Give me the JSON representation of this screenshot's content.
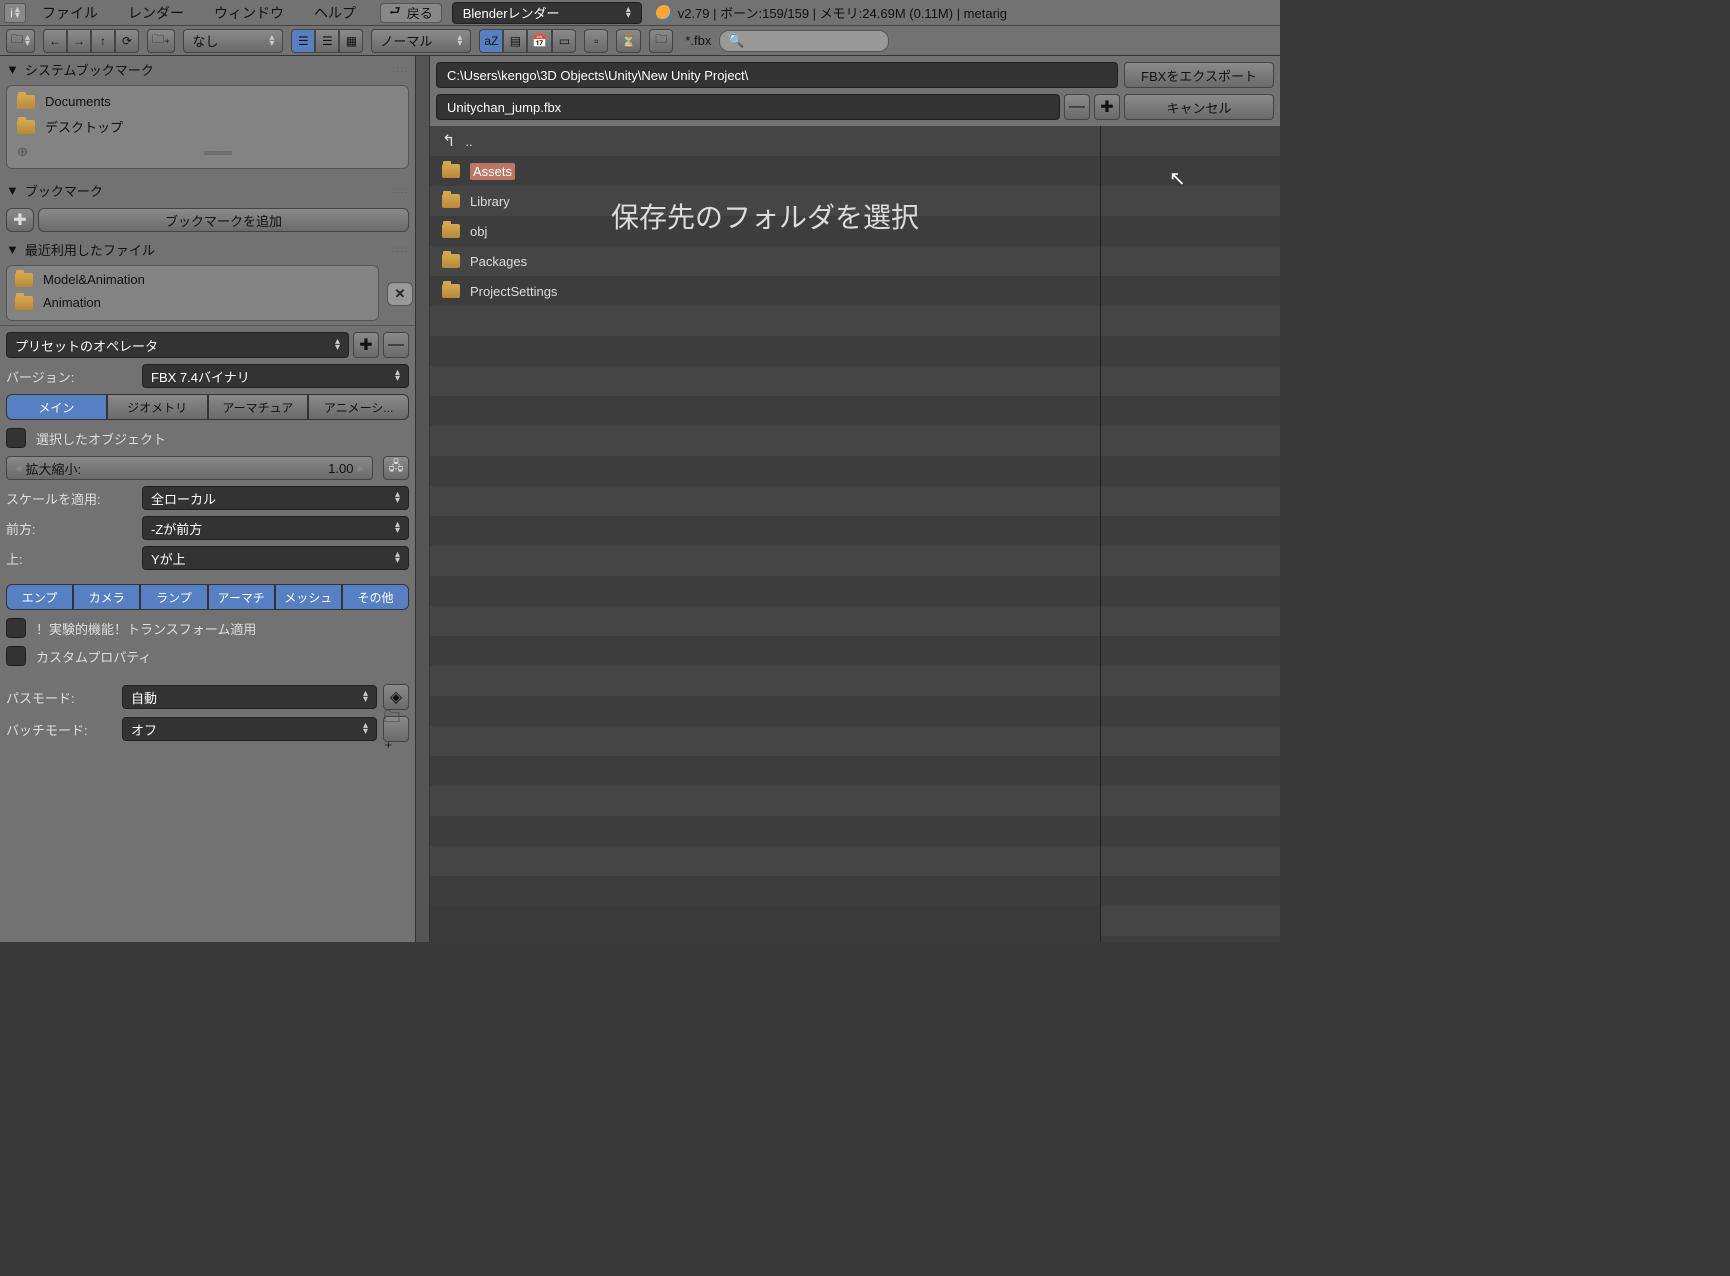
{
  "menubar": {
    "info_icon": "i",
    "items": [
      "ファイル",
      "レンダー",
      "ウィンドウ",
      "ヘルプ"
    ],
    "back": "戻る",
    "renderer": "Blenderレンダー",
    "status": "v2.79 | ボーン:159/159 | メモリ:24.69M (0.11M) | metarig"
  },
  "toolbar": {
    "none_label": "なし",
    "normal_label": "ノーマル",
    "filter_text": "*.fbx"
  },
  "system_bookmarks": {
    "title": "システムブックマーク",
    "items": [
      "Documents",
      "デスクトップ"
    ]
  },
  "bookmarks": {
    "title": "ブックマーク",
    "add_label": "ブックマークを追加"
  },
  "recent": {
    "title": "最近利用したファイル",
    "items": [
      "Model&Animation",
      "Animation"
    ]
  },
  "operator": {
    "title": "プリセットのオペレータ",
    "version_label": "バージョン:",
    "version_value": "FBX 7.4バイナリ",
    "tabs": [
      "メイン",
      "ジオメトリ",
      "アーマチュア",
      "アニメーシ..."
    ],
    "selected_objects": "選択したオブジェクト",
    "scale_label": "拡大縮小:",
    "scale_value": "1.00",
    "apply_scale_label": "スケールを適用:",
    "apply_scale_value": "全ローカル",
    "forward_label": "前方:",
    "forward_value": "-Zが前方",
    "up_label": "上:",
    "up_value": "Yが上",
    "toggles": [
      "エンプ",
      "カメラ",
      "ランプ",
      "アーマチ",
      "メッシュ",
      "その他"
    ],
    "experimental": "！実験的機能！トランスフォーム適用",
    "custom_props": "カスタムプロパティ",
    "path_mode_label": "パスモード:",
    "path_mode_value": "自動",
    "batch_mode_label": "バッチモード:",
    "batch_mode_value": "オフ"
  },
  "filebrowser": {
    "path": "C:\\Users\\kengo\\3D Objects\\Unity\\New Unity Project\\",
    "filename": "Unitychan_jump.fbx",
    "export_btn": "FBXをエクスポート",
    "cancel_btn": "キャンセル",
    "parent": "..",
    "entries": [
      "Assets",
      "Library",
      "obj",
      "Packages",
      "ProjectSettings"
    ],
    "overlay": "保存先のフォルダを選択"
  }
}
